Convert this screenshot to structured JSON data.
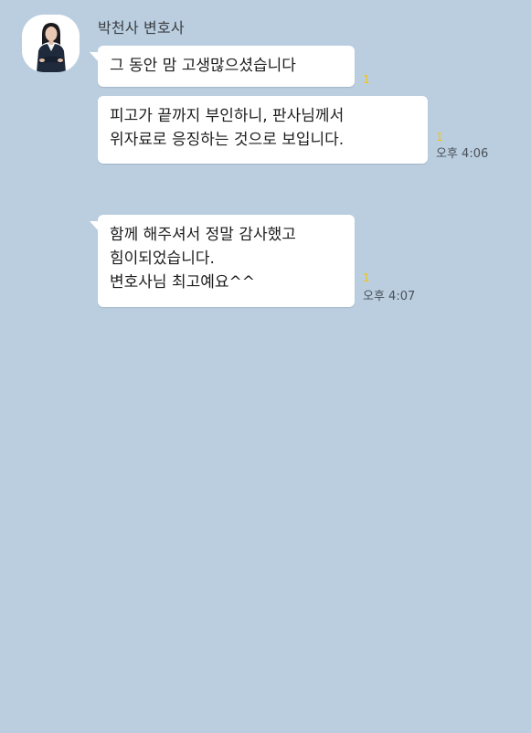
{
  "chat": {
    "sender_name": "박천사 변호사",
    "messages": [
      {
        "lines": [
          "그 동안 맘 고생많으셨습니다"
        ],
        "unread": "1",
        "time": ""
      },
      {
        "lines": [
          "피고가 끝까지 부인하니, 판사님께서",
          "위자료로 응징하는 것으로 보입니다."
        ],
        "unread": "1",
        "time": "오후 4:06"
      },
      {
        "lines": [
          "함께 해주셔서 정말 감사했고",
          "힘이되었습니다.",
          "변호사님 최고예요^^"
        ],
        "unread": "1",
        "time": "오후 4:07"
      }
    ]
  },
  "icons": {
    "avatar": "lawyer-profile-photo"
  },
  "colors": {
    "background": "#bacee0",
    "bubble": "#ffffff",
    "unread": "#f2c60a",
    "text": "#1d1d1d"
  }
}
